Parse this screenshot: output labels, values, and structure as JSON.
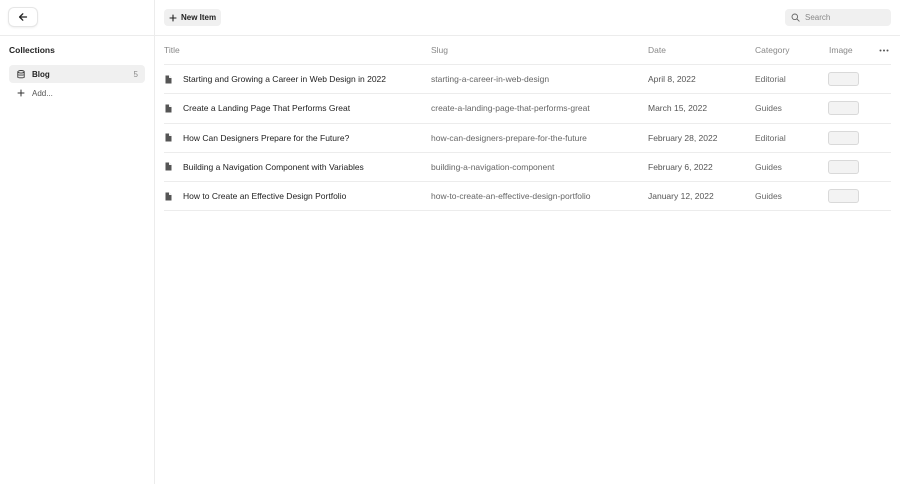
{
  "sidebar": {
    "collections_label": "Collections",
    "collections": [
      {
        "label": "Blog",
        "count": "5"
      }
    ],
    "add_label": "Add..."
  },
  "toolbar": {
    "new_item_label": "New Item",
    "search_placeholder": "Search"
  },
  "table": {
    "columns": {
      "title": "Title",
      "slug": "Slug",
      "date": "Date",
      "category": "Category",
      "image": "Image"
    },
    "rows": [
      {
        "title": "Starting and Growing a Career in Web Design in 2022",
        "slug": "starting-a-career-in-web-design",
        "date": "April 8, 2022",
        "category": "Editorial"
      },
      {
        "title": "Create a Landing Page That Performs Great",
        "slug": "create-a-landing-page-that-performs-great",
        "date": "March 15, 2022",
        "category": "Guides"
      },
      {
        "title": "How Can Designers Prepare for the Future?",
        "slug": "how-can-designers-prepare-for-the-future",
        "date": "February 28, 2022",
        "category": "Editorial"
      },
      {
        "title": "Building a Navigation Component with Variables",
        "slug": "building-a-navigation-component",
        "date": "February 6, 2022",
        "category": "Guides"
      },
      {
        "title": "How to Create an Effective Design Portfolio",
        "slug": "how-to-create-an-effective-design-portfolio",
        "date": "January 12, 2022",
        "category": "Guides"
      }
    ]
  },
  "icons": {
    "back": "arrow-left-icon",
    "collection": "database-icon",
    "add": "plus-icon",
    "new": "plus-icon",
    "search": "search-icon",
    "doc": "document-icon",
    "more": "more-horizontal-icon"
  }
}
